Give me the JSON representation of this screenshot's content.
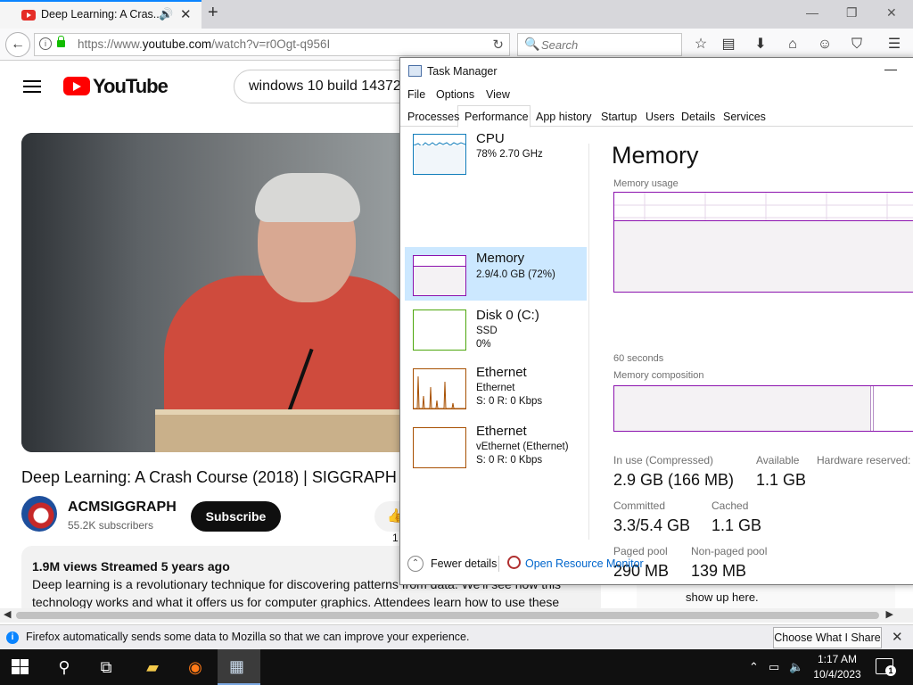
{
  "browser": {
    "tab_title": "Deep Learning: A Cras...",
    "url_prefix": "https://www.",
    "url_domain": "youtube.com",
    "url_path": "/watch?v=r0Ogt-q956I",
    "search_placeholder": "Search"
  },
  "youtube": {
    "logo_text": "YouTube",
    "search_value": "windows 10 build 14372",
    "video_title": "Deep Learning: A Crash Course (2018) | SIGGRAPH",
    "channel_name": "ACMSIGGRAPH",
    "subscribers": "55.2K subscribers",
    "subscribe_label": "Subscribe",
    "like_count": "1",
    "views_line": "1.9M views  Streamed 5 years ago",
    "desc_line1": "Deep learning is a revolutionary technique for discovering patterns from data. We'll see how this",
    "desc_line2": "technology works and what it offers us for computer graphics. Attendees learn how to use these",
    "side_text": "show up here."
  },
  "notification": {
    "message": "Firefox automatically sends some data to Mozilla so that we can improve your experience.",
    "button": "Choose What I Share"
  },
  "taskbar": {
    "time": "1:17 AM",
    "date": "10/4/2023",
    "notif_count": "1"
  },
  "taskmanager": {
    "title": "Task Manager",
    "menu": [
      "File",
      "Options",
      "View"
    ],
    "tabs": [
      "Processes",
      "Performance",
      "App history",
      "Startup",
      "Users",
      "Details",
      "Services"
    ],
    "resources": [
      {
        "name": "CPU",
        "sub1": "78%  2.70 GHz",
        "sub2": "",
        "color": "#117dbb"
      },
      {
        "name": "Memory",
        "sub1": "2.9/4.0 GB (72%)",
        "sub2": "",
        "color": "#8b12ae"
      },
      {
        "name": "Disk 0 (C:)",
        "sub1": "SSD",
        "sub2": "0%",
        "color": "#4da60c"
      },
      {
        "name": "Ethernet",
        "sub1": "Ethernet",
        "sub2": "S: 0  R: 0 Kbps",
        "color": "#a74f01"
      },
      {
        "name": "Ethernet",
        "sub1": "vEthernet (Ethernet)",
        "sub2": "S: 0  R: 0 Kbps",
        "color": "#a74f01"
      }
    ],
    "memory": {
      "heading": "Memory",
      "usage_label": "Memory usage",
      "usage_fraction": 0.72,
      "seconds_label": "60 seconds",
      "composition_label": "Memory composition",
      "in_use_label": "In use (Compressed)",
      "in_use_value": "2.9 GB (166 MB)",
      "available_label": "Available",
      "available_value": "1.1 GB",
      "hw_reserved_label": "Hardware reserved:",
      "committed_label": "Committed",
      "committed_value": "3.3/5.4 GB",
      "cached_label": "Cached",
      "cached_value": "1.1 GB",
      "paged_label": "Paged pool",
      "paged_value": "290 MB",
      "nonpaged_label": "Non-paged pool",
      "nonpaged_value": "139 MB"
    },
    "fewer_details": "Fewer details",
    "open_resource_monitor": "Open Resource Monitor"
  }
}
